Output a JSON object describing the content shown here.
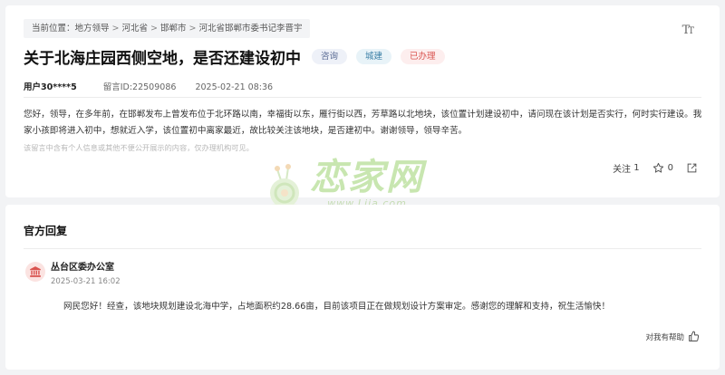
{
  "breadcrumb": {
    "prefix": "当前位置：",
    "items": [
      "地方领导",
      "河北省",
      "邯郸市",
      "河北省邯郸市委书记李晋宇"
    ],
    "separator": ">"
  },
  "font_size_toggle": {
    "label_large": "T",
    "label_small": "T"
  },
  "title": "关于北海庄园西侧空地，是否还建设初中",
  "tags": {
    "type": "咨询",
    "domain": "城建",
    "status": "已办理"
  },
  "meta": {
    "user": "用户30****5",
    "message_id": "留言ID:22509086",
    "date": "2025-02-21 08:36"
  },
  "message": {
    "body": "您好，领导，在多年前，在邯郸发布上曾发布位于北环路以南，幸福街以东，雁行街以西，芳草路以北地块，该位置计划建设初中，请问现在该计划是否实行，何时实行建设。我家小孩即将进入初中，想就近入学，该位置初中离家最近，故比较关注该地块，是否建初中。谢谢领导，领导辛苦。",
    "note": "该留言中含有个人信息或其他不便公开展示的内容，仅办理机构可见。"
  },
  "actions": {
    "follow_label": "关注",
    "follow_count": "1",
    "like_count": "0"
  },
  "watermark": {
    "main": "恋家网",
    "url": "www.Ljia.com"
  },
  "reply": {
    "heading": "官方回复",
    "org_name": "丛台区委办公室",
    "time": "2025-03-21 16:02",
    "body": "网民您好！经查，该地块规划建设北海中学，占地面积约28.66亩，目前该项目正在做规划设计方案审定。感谢您的理解和支持，祝生活愉快！",
    "helpful_label": "对我有帮助"
  },
  "colors": {
    "status_red": "#d9534f",
    "org_icon_red": "#d9534f",
    "watermark_green": "#c8e6b0"
  },
  "icons": [
    "font-size-icon",
    "star-icon",
    "share-icon",
    "government-building-icon",
    "thumbs-up-icon",
    "snail-logo-icon"
  ]
}
